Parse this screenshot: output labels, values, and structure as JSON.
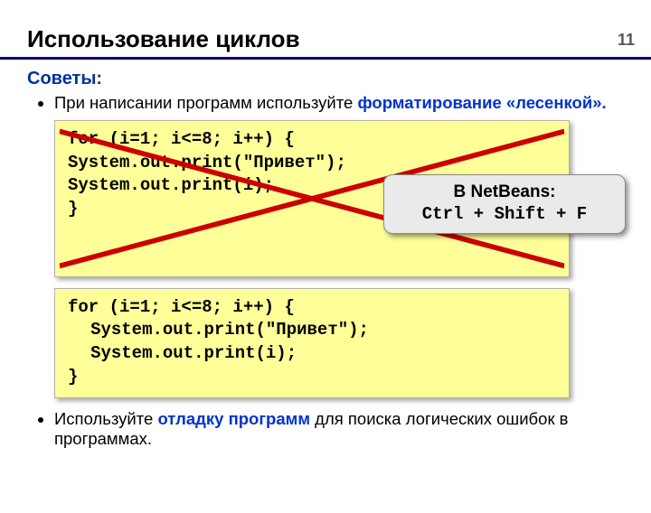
{
  "page_number": "11",
  "title": "Использование циклов",
  "subhead": "Советы:",
  "bullet1_prefix": "При написании программ используйте ",
  "bullet1_hl": "форматирование «лесенкой».",
  "bad_code": {
    "l1": "for (i=1; i<=8; i++) {",
    "l2": "System.out.print(\"Привет\");",
    "l3": "System.out.print(i);",
    "l4": "}"
  },
  "good_code": {
    "l1": "for (i=1; i<=8; i++) {",
    "l2": "System.out.print(\"Привет\");",
    "l3": "System.out.print(i);",
    "l4": "}"
  },
  "callout": {
    "line1": "В NetBeans:",
    "line2": "Ctrl + Shift + F"
  },
  "bullet2_prefix": "Используйте ",
  "bullet2_hl": "отладку программ",
  "bullet2_suffix": " для поиска логических ошибок в программах."
}
